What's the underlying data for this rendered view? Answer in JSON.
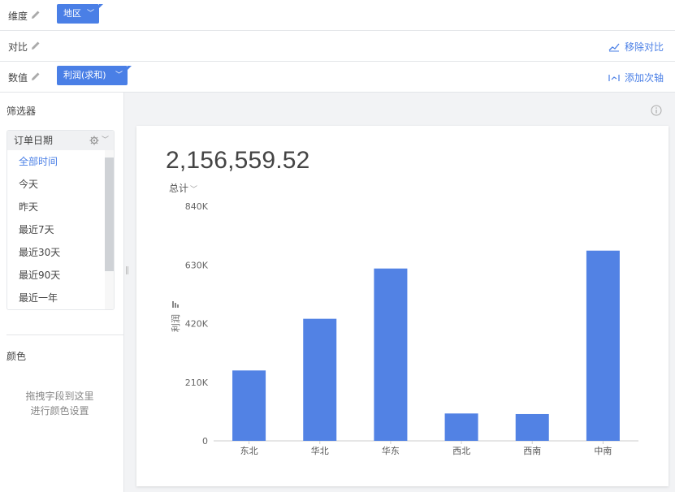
{
  "shelves": {
    "dimension": {
      "label": "维度",
      "pill": "地区"
    },
    "compare": {
      "label": "对比",
      "action": "移除对比"
    },
    "value": {
      "label": "数值",
      "pill": "利润(求和)",
      "action": "添加次轴"
    }
  },
  "filters": {
    "title": "筛选器",
    "field": "订单日期",
    "items": [
      "全部时间",
      "今天",
      "昨天",
      "最近7天",
      "最近30天",
      "最近90天",
      "最近一年"
    ],
    "active_index": 0
  },
  "color_section": {
    "title": "颜色",
    "hint_line1": "拖拽字段到这里",
    "hint_line2": "进行颜色设置"
  },
  "summary": {
    "value": "2,156,559.52",
    "label": "总计"
  },
  "colors": {
    "accent": "#4a7fe6",
    "bar": "#5282e4"
  },
  "chart_data": {
    "type": "bar",
    "categories": [
      "东北",
      "华北",
      "华东",
      "西北",
      "西南",
      "中南"
    ],
    "values": [
      252000,
      437000,
      617000,
      98000,
      96000,
      681000
    ],
    "ylabel": "利润",
    "ylim": [
      0,
      840000
    ],
    "yticks": [
      0,
      210000,
      420000,
      630000,
      840000
    ],
    "ytick_labels": [
      "0",
      "210K",
      "420K",
      "630K",
      "840K"
    ],
    "grid": false
  }
}
